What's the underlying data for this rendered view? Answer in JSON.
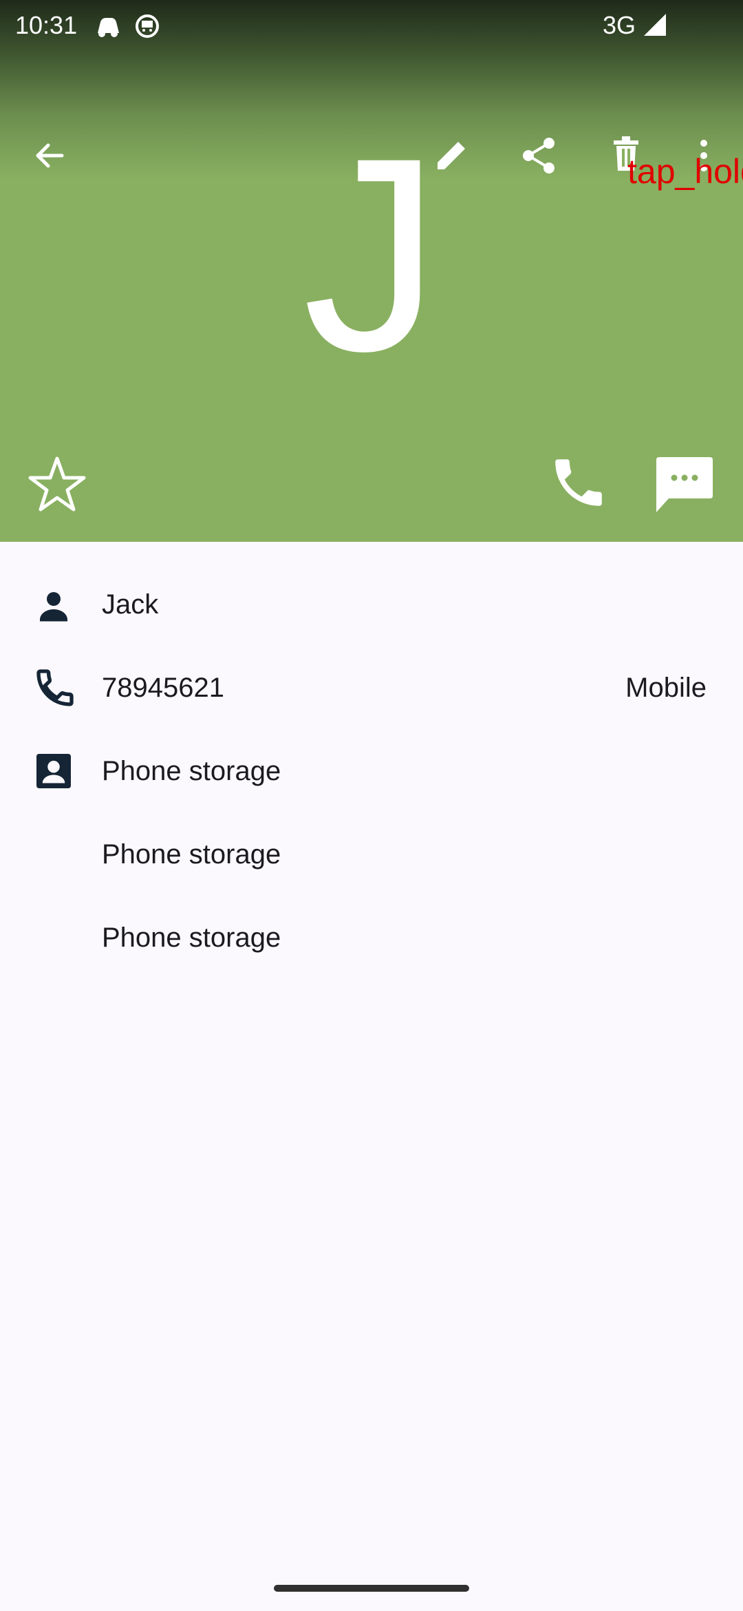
{
  "status_bar": {
    "time": "10:31",
    "network": "3G",
    "icons": [
      "cloud-icon",
      "face-icon",
      "signal-icon"
    ]
  },
  "toolbar": {
    "icons": [
      "back-arrow-icon",
      "edit-icon",
      "share-icon",
      "delete-icon",
      "more-vert-icon"
    ]
  },
  "contact": {
    "avatar_letter": "J",
    "header_color": "#89b061"
  },
  "overlay": {
    "label": "tap_hold"
  },
  "actions": {
    "icons": [
      "star-outline-icon",
      "phone-icon",
      "message-icon"
    ]
  },
  "details": {
    "name": "Jack",
    "phone_number": "78945621",
    "phone_type": "Mobile",
    "sources": [
      "Phone storage",
      "Phone storage",
      "Phone storage"
    ]
  }
}
